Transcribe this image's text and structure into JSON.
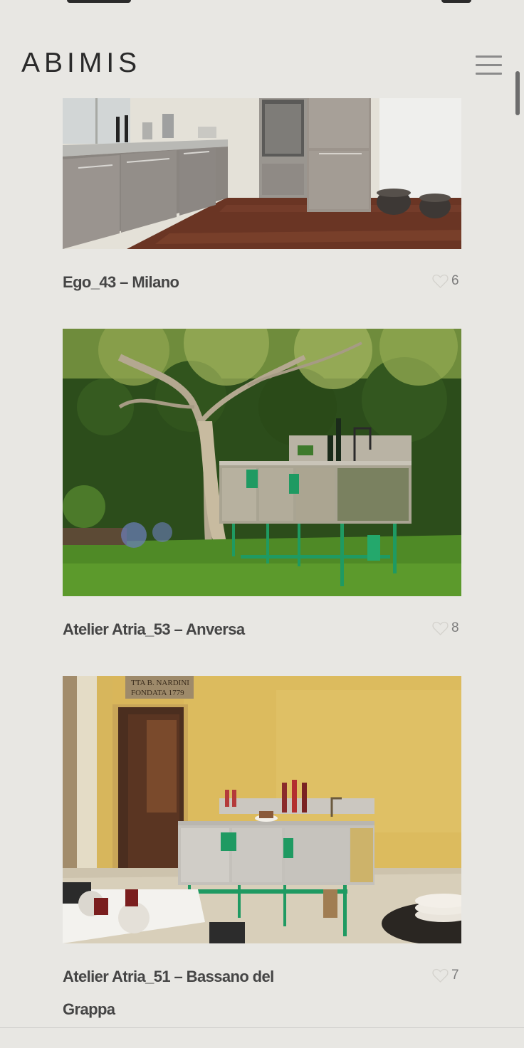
{
  "brand": {
    "logo_text": "ABIMIS"
  },
  "header": {
    "menu_icon": "hamburger-menu-icon"
  },
  "projects": [
    {
      "title": "Ego_43 – Milano",
      "likes": "6",
      "like_icon": "heart-outline-icon"
    },
    {
      "title": "Atelier Atria_53 – Anversa",
      "likes": "8",
      "like_icon": "heart-outline-icon"
    },
    {
      "title": "Atelier Atria_51 – Bassano del Grappa",
      "likes": "7",
      "like_icon": "heart-outline-icon"
    }
  ],
  "images": {
    "project_3_sign": "TTA B. NARDINI\nFONDATA 1779"
  },
  "colors": {
    "background": "#e8e7e3",
    "text": "#454545",
    "accent_green": "#1f9a62"
  }
}
